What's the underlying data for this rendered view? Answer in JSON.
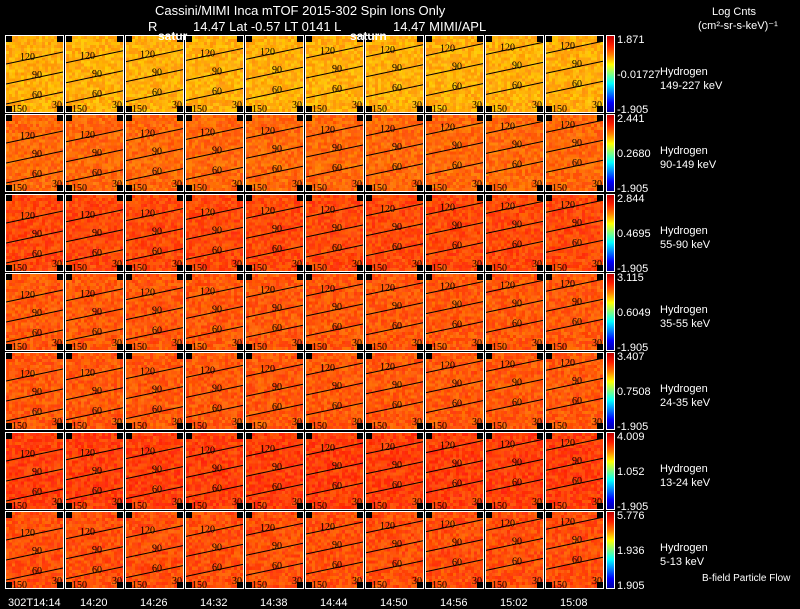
{
  "header": {
    "title": "Cassini/MIMI Inca mTOF  2015-302   Spin   Ions Only",
    "subtitle_r": "R",
    "subtitle_rest": "14.47 Lat -0.57 LT 0141 L",
    "subtitle_l": "14.47  MIMI/APL",
    "saturn_label_1": "satur",
    "saturn_label_2": "saturn"
  },
  "units": {
    "line1": "Log Cnts",
    "line2": "(cm²-sr-s-keV)⁻¹"
  },
  "footer_note": "B-field Particle Flow",
  "chart_data": {
    "type": "heatmap",
    "title": "Cassini/MIMI Inca mTOF  2015-302   Spin   Ions Only",
    "x_tick_labels": [
      "302T14:14",
      "14:20",
      "14:26",
      "14:32",
      "14:38",
      "14:44",
      "14:50",
      "14:56",
      "15:02",
      "15:08"
    ],
    "contour_labels": [
      "150",
      "120",
      "90",
      "60",
      "30"
    ],
    "colormap": "rainbow (blue low, red high)",
    "rows": [
      {
        "species": "Hydrogen",
        "energy": "149-227 keV",
        "cmax": "1.871",
        "cmid": "-0.01727",
        "cmin": "-1.905",
        "base_color": "#ffb000"
      },
      {
        "species": "Hydrogen",
        "energy": "90-149 keV",
        "cmax": "2.441",
        "cmid": "0.2680",
        "cmin": "-1.905",
        "base_color": "#ff6a00"
      },
      {
        "species": "Hydrogen",
        "energy": "55-90 keV",
        "cmax": "2.844",
        "cmid": "0.4695",
        "cmin": "-1.905",
        "base_color": "#ff4a00"
      },
      {
        "species": "Hydrogen",
        "energy": "35-55 keV",
        "cmax": "3.115",
        "cmid": "0.6049",
        "cmin": "-1.905",
        "base_color": "#ff5a00"
      },
      {
        "species": "Hydrogen",
        "energy": "24-35 keV",
        "cmax": "3.407",
        "cmid": "0.7508",
        "cmin": "-1.905",
        "base_color": "#ff5a00"
      },
      {
        "species": "Hydrogen",
        "energy": "13-24 keV",
        "cmax": "4.009",
        "cmid": "1.052",
        "cmin": "-1.905",
        "base_color": "#ff4000"
      },
      {
        "species": "Hydrogen",
        "energy": "5-13 keV",
        "cmax": "5.776",
        "cmid": "1.936",
        "cmin": "1.905",
        "base_color": "#ff5000"
      }
    ]
  }
}
